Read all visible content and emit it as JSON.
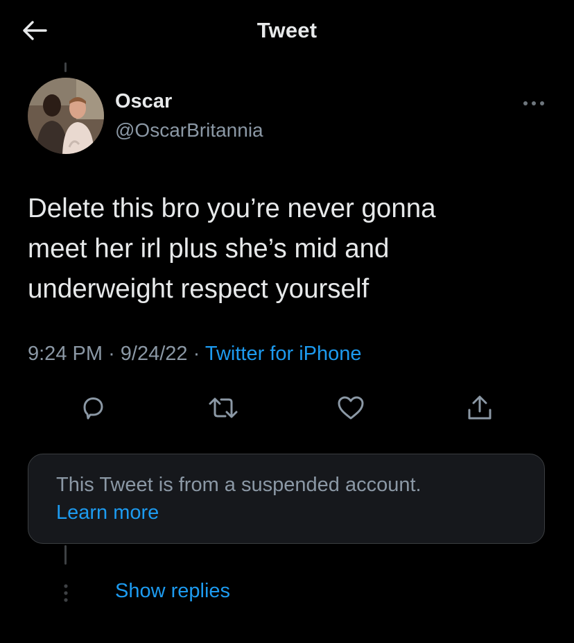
{
  "header": {
    "title": "Tweet",
    "back_icon": "arrow-left-icon"
  },
  "tweet": {
    "author": {
      "name": "Oscar",
      "handle": "@OscarBritannia",
      "avatar": "avatar-photo"
    },
    "text": "Delete this bro you’re never gonna\nmeet her irl plus she’s mid and\nunderweight respect yourself",
    "time": "9:24 PM",
    "separator": "·",
    "date": "9/24/22",
    "source": "Twitter for iPhone",
    "actions": [
      {
        "name": "reply",
        "icon": "reply-icon"
      },
      {
        "name": "retweet",
        "icon": "retweet-icon"
      },
      {
        "name": "like",
        "icon": "heart-icon"
      },
      {
        "name": "share",
        "icon": "share-icon"
      }
    ]
  },
  "notice": {
    "text": "This Tweet is from a suspended account.",
    "link": "Learn more"
  },
  "replies": {
    "link": "Show replies"
  },
  "colors": {
    "background": "#000000",
    "text": "#e7e9ea",
    "muted": "#8b98a5",
    "accent": "#1d9bf0",
    "border": "#3b3e41",
    "card": "#16181c"
  }
}
